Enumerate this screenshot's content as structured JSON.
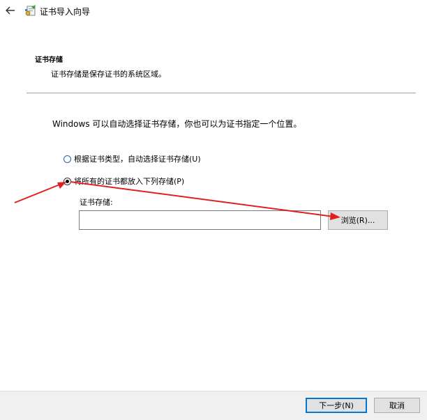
{
  "titlebar": {
    "title": "证书导入向导"
  },
  "header": {
    "section_title": "证书存储",
    "section_desc": "证书存储是保存证书的系统区域。"
  },
  "body": {
    "intro": "Windows 可以自动选择证书存储，你也可以为证书指定一个位置。",
    "radio_auto_label": "根据证书类型，自动选择证书存储(U)",
    "radio_manual_label": "将所有的证书都放入下列存储(P)",
    "selected_option": "manual",
    "store_label": "证书存储:",
    "store_value": "",
    "browse_label": "浏览(R)..."
  },
  "footer": {
    "next_label": "下一步(N)",
    "cancel_label": "取消"
  },
  "colors": {
    "annotation_arrow": "#e02020",
    "button_focus": "#0078d7",
    "footer_bg": "#f0f0f0"
  },
  "icons": [
    "back-arrow-icon",
    "certificate-wizard-icon"
  ]
}
